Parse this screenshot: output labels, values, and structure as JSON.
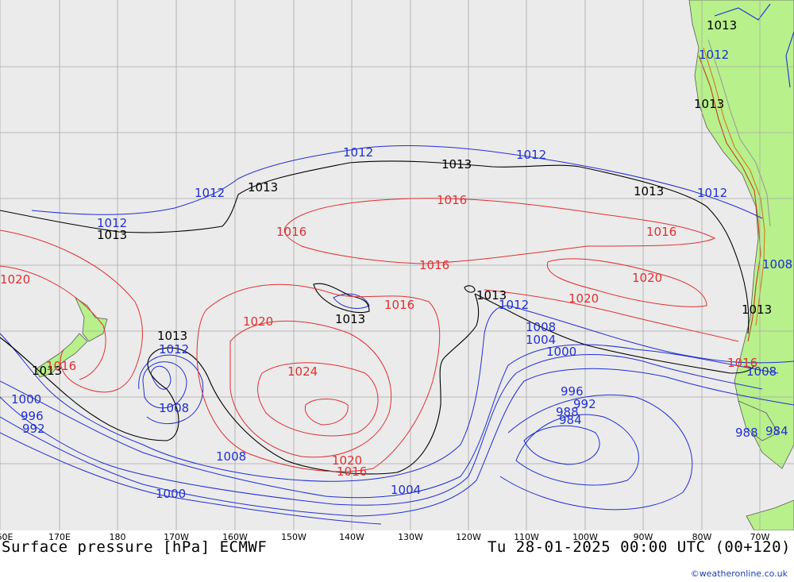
{
  "title": "Surface pressure [hPa] ECMWF",
  "valid_time": "Tu 28-01-2025 00:00 UTC (00+120)",
  "credit": "©weatheronline.co.uk",
  "colors": {
    "background": "#ebebeb",
    "land": "#b8f08c",
    "grid": "#a9a9a9",
    "isobar_low": "#2030d0",
    "isobar_1013": "#000000",
    "isobar_high": "#e03030"
  },
  "longitude_labels": [
    "60E",
    "170E",
    "180",
    "170W",
    "160W",
    "150W",
    "140W",
    "130W",
    "120W",
    "110W",
    "100W",
    "90W",
    "80W",
    "70W"
  ],
  "isobar_labels": {
    "blue": [
      "1012",
      "1012",
      "1012",
      "1012",
      "1012",
      "1012",
      "1012",
      "1012",
      "1008",
      "1004",
      "1000",
      "996",
      "992",
      "988",
      "984",
      "1000",
      "996",
      "992",
      "1008",
      "1008",
      "1000",
      "1004",
      "1008",
      "988",
      "984",
      "1008"
    ],
    "black": [
      "1013",
      "1013",
      "1013",
      "1013",
      "1013",
      "1013",
      "1013",
      "1013",
      "1013",
      "1013",
      "1013"
    ],
    "red": [
      "1016",
      "1016",
      "1016",
      "1016",
      "1016",
      "1020",
      "1020",
      "1020",
      "1024",
      "1020",
      "1016",
      "1020",
      "1016",
      "1016"
    ]
  }
}
